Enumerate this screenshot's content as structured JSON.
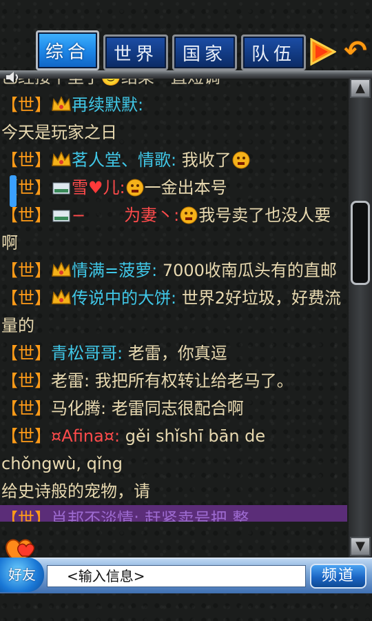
{
  "tabs": [
    {
      "label": "综合",
      "active": true
    },
    {
      "label": "世界",
      "active": false
    },
    {
      "label": "国家",
      "active": false
    },
    {
      "label": "队伍",
      "active": false
    }
  ],
  "icons": {
    "speaker": "speaker-icon",
    "crown": "crown-icon",
    "card": "card-icon",
    "emoji": "emoji-icon",
    "play": "play-arrow-icon",
    "back": "back-arrow-icon",
    "hearts": "hearts-icon"
  },
  "colors": {
    "channel": "#ff9b18",
    "name_cyan": "#40c8e8",
    "name_red": "#ff4b4b",
    "text": "#e8d9b0",
    "tab_active": "#1e88e8",
    "tab_inactive": "#123a82"
  },
  "chat": {
    "partial_top": "已经接下里了🙂结果一直短调",
    "messages": [
      {
        "channel": "【世】",
        "name": "再续默默:",
        "text": ""
      },
      {
        "text_only": "今天是玩家之日"
      },
      {
        "channel": "【世】",
        "name": "茗人堂、情歌:",
        "text": " 我收了"
      },
      {
        "channel": "【世】",
        "name_a": "雪",
        "heart": "♥",
        "name_b": "儿:",
        "text": "一金出本号"
      },
      {
        "channel": "【世】",
        "name_a": "−",
        "name_b": "为妻丶:",
        "text": "我号卖了也没人要啊"
      },
      {
        "channel": "【世】",
        "name": "情满=菠萝:",
        "text": " 7000收南瓜头有的直邮"
      },
      {
        "channel": "【世】",
        "name": "传说中的大饼:",
        "text": " 世界2好垃圾，好费流量的"
      },
      {
        "channel": "【世】",
        "name": "青松哥哥:",
        "text": " 老雷，你真逗"
      },
      {
        "channel": "【世】",
        "name": "老雷:",
        "text": " 我把所有权转让给老马了。"
      },
      {
        "channel": "【世】",
        "name": "马化腾:",
        "text": " 老雷同志很配合啊"
      },
      {
        "channel": "【世】",
        "name": "¤Afina¤:",
        "text": " gěi shǐshī bān de chǒngwù, qǐng"
      },
      {
        "text_only": "给史诗般的宠物，请"
      },
      {
        "channel": "【世】",
        "name": "肖邦不淡情:",
        "text": " 赶紧卖号把 整"
      }
    ]
  },
  "bottom": {
    "friend_label": "好友",
    "input_placeholder": "<输入信息>",
    "channel_button": "频道"
  },
  "scroll": {
    "up": "▲",
    "down": "▼"
  }
}
